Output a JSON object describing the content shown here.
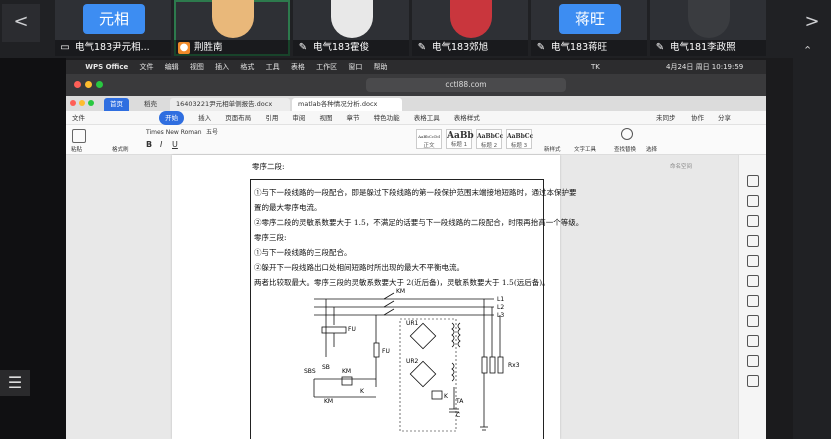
{
  "conference": {
    "tiles": [
      {
        "badge": "元相",
        "name": "电气183尹元相...",
        "icon": "screen-share-icon",
        "active": false
      },
      {
        "badge": "",
        "name": "荆胜南",
        "icon": "person-icon",
        "active": true
      },
      {
        "badge": "",
        "name": "电气183霍俊",
        "icon": "mic-muted-icon",
        "active": false
      },
      {
        "badge": "",
        "name": "电气183郊旭",
        "icon": "mic-muted-icon",
        "active": false
      },
      {
        "badge": "蒋旺",
        "name": "电气183蒋旺",
        "icon": "mic-muted-icon",
        "active": false
      },
      {
        "badge": "",
        "name": "电气181李政照",
        "icon": "mic-muted-icon",
        "active": false
      }
    ],
    "prev_label": "<",
    "next_label": ">"
  },
  "mac_menubar": {
    "items": [
      "WPS Office",
      "文件",
      "编辑",
      "视图",
      "插入",
      "格式",
      "工具",
      "表格",
      "工作区",
      "窗口",
      "帮助"
    ],
    "clock": "4月24日 周日 10:19:59",
    "input_method": "TK"
  },
  "browser": {
    "url": "cctl88.com"
  },
  "wps": {
    "tabs": [
      {
        "label": "首页",
        "home": true
      },
      {
        "label": "稻壳",
        "home": false
      },
      {
        "label": "16403221尹元相单侧报告.docx",
        "home": false
      },
      {
        "label": "matlab各种情况分析.docx",
        "home": false
      }
    ],
    "menu": [
      "文件",
      "开始",
      "插入",
      "页面布局",
      "引用",
      "审阅",
      "视图",
      "章节",
      "特色功能",
      "表格工具",
      "表格样式"
    ],
    "menu_right": [
      "未同步",
      "协作",
      "分享"
    ],
    "font_name": "Times New Roman",
    "font_size": "五号",
    "styles": [
      {
        "sample": "AaBbCcDd",
        "label": "正文"
      },
      {
        "sample": "AaBb",
        "label": "标题 1"
      },
      {
        "sample": "AaBbCc",
        "label": "标题 2"
      },
      {
        "sample": "AaBbCc",
        "label": "标题 3"
      }
    ],
    "toolbar_labels": [
      "粘贴",
      "格式刷",
      "新样式",
      "文字工具",
      "查找替换",
      "选择"
    ],
    "side_note": "命名空间"
  },
  "document": {
    "lines": [
      "零序二段:",
      "①与下一段线路的一段配合，即是躲过下段线路的第一段保护范围末端接地短路时，通过本保护要",
      "置的最大零序电流。",
      "②零序二段的灵敏系数要大于 1.5，不满足的话要与下一段线路的二段配合，时限再抬高一个等级。",
      "零序三段:",
      "①与下一段线路的三段配合。",
      "②躲开下一段线路出口处相间短路时所出现的最大不平衡电流。",
      "两者比较取最大。零序三段的灵敏系数要大于 2(近后备)，灵敏系数要大于 1.5(远后备)。"
    ],
    "diagram_labels": {
      "km_top": "KM",
      "l1": "L1",
      "l2": "L2",
      "l3": "L3",
      "fu1": "FU",
      "fu2": "FU",
      "ur1": "UR1",
      "ur2": "UR2",
      "sbs": "SBS",
      "sb": "SB",
      "km_mid": "KM",
      "km_bot": "KM",
      "k1": "K",
      "k2": "K",
      "ta": "TA",
      "c": "C",
      "rx": "Rx3"
    }
  }
}
